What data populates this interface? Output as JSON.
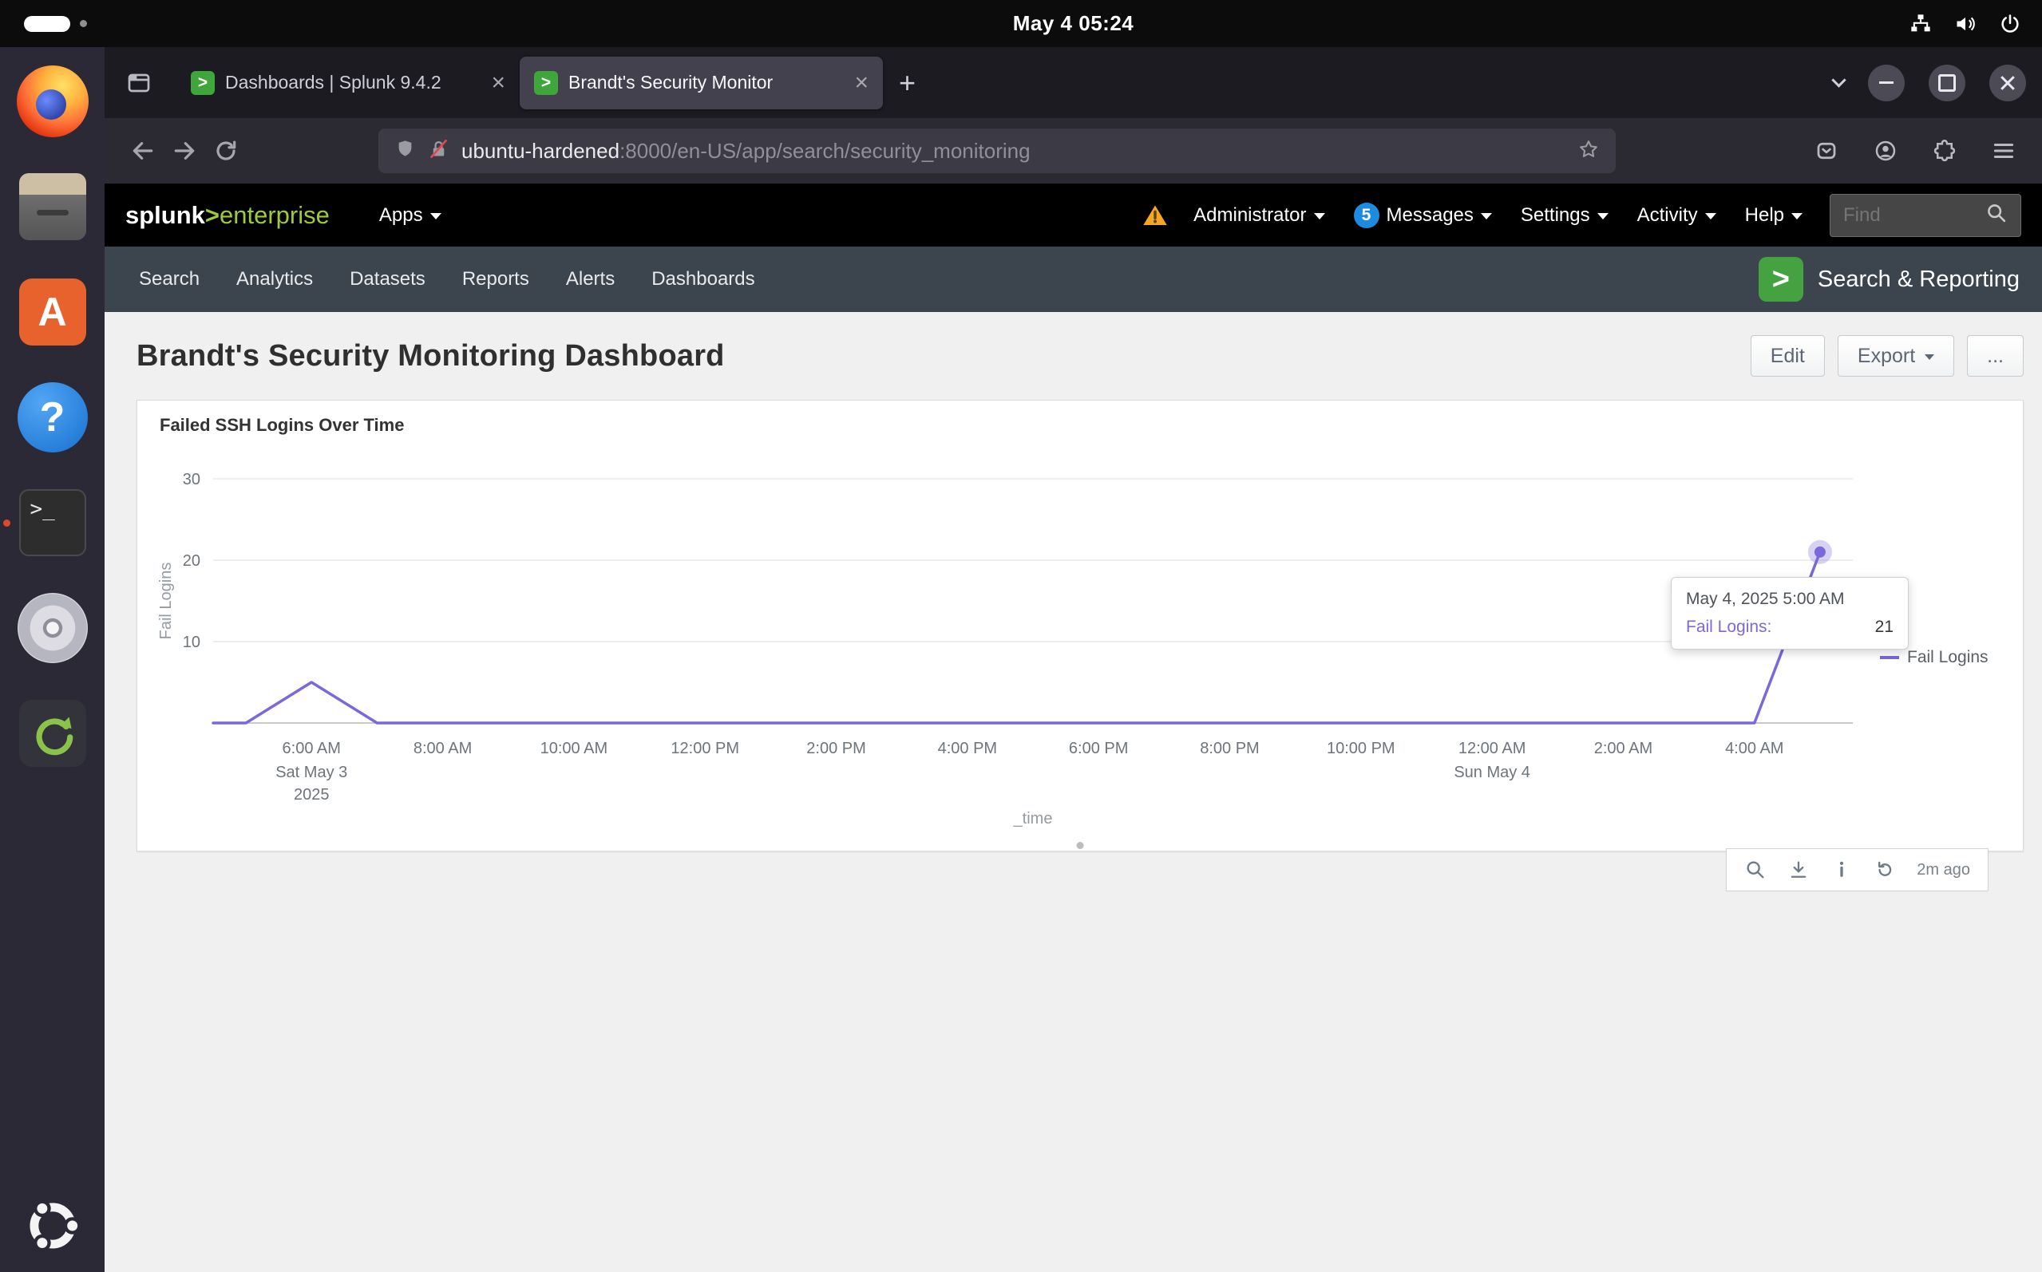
{
  "system_bar": {
    "clock": "May 4  05:24"
  },
  "dock": {
    "items": [
      "Firefox",
      "Files",
      "Text Editor",
      "Help",
      "Terminal",
      "Disc Burner",
      "Software Updater",
      "Ubuntu Desktop"
    ]
  },
  "browser": {
    "tabs": [
      {
        "label": "Dashboards | Splunk 9.4.2",
        "active": false
      },
      {
        "label": "Brandt's Security Monitor",
        "active": true
      }
    ],
    "new_tab": "+",
    "url_host": "ubuntu-hardened",
    "url_path": ":8000/en-US/app/search/security_monitoring"
  },
  "splunk_header": {
    "logo_splunk": "splunk",
    "logo_gt": ">",
    "logo_enterprise": "enterprise",
    "apps": "Apps",
    "administrator": "Administrator",
    "messages_count": "5",
    "messages": "Messages",
    "settings": "Settings",
    "activity": "Activity",
    "help": "Help",
    "find_placeholder": "Find"
  },
  "app_nav": {
    "items": [
      "Search",
      "Analytics",
      "Datasets",
      "Reports",
      "Alerts",
      "Dashboards"
    ],
    "app_logo_glyph": ">",
    "app_name": "Search & Reporting"
  },
  "page": {
    "title": "Brandt's Security Monitoring Dashboard",
    "edit": "Edit",
    "export": "Export",
    "more": "..."
  },
  "panel": {
    "title": "Failed SSH Logins Over Time",
    "refresh_age": "2m ago"
  },
  "tooltip": {
    "timestamp": "May 4, 2025 5:00 AM",
    "series": "Fail Logins:",
    "value": "21"
  },
  "icons": {
    "favicon": "green-splunk-chevron",
    "warning-icon": "orange-triangle-exclamation",
    "find-icon": "magnifier",
    "accent_green": "#44a340",
    "series_purple": "#7b68d9"
  },
  "chart_data": {
    "type": "line",
    "title": "Failed SSH Logins Over Time",
    "xlabel": "_time",
    "ylabel": "Fail Logins",
    "ylim": [
      0,
      32
    ],
    "yticks": [
      10,
      20,
      30
    ],
    "legend": [
      "Fail Logins"
    ],
    "legend_position": "right",
    "grid": "horizontal",
    "series_color": "#7b68d9",
    "x": [
      "5:00 AM",
      "6:00 AM",
      "7:00 AM",
      "8:00 AM",
      "9:00 AM",
      "10:00 AM",
      "11:00 AM",
      "12:00 PM",
      "1:00 PM",
      "2:00 PM",
      "3:00 PM",
      "4:00 PM",
      "5:00 PM",
      "6:00 PM",
      "7:00 PM",
      "8:00 PM",
      "9:00 PM",
      "10:00 PM",
      "11:00 PM",
      "12:00 AM",
      "1:00 AM",
      "2:00 AM",
      "3:00 AM",
      "4:00 AM",
      "5:00 AM"
    ],
    "values": [
      0,
      5,
      0,
      0,
      0,
      0,
      0,
      0,
      0,
      0,
      0,
      0,
      0,
      0,
      0,
      0,
      0,
      0,
      0,
      0,
      0,
      0,
      0,
      0,
      21
    ],
    "x_tick_labels": [
      {
        "index": 1,
        "label": "6:00 AM",
        "sub": [
          "Sat May 3",
          "2025"
        ]
      },
      {
        "index": 3,
        "label": "8:00 AM"
      },
      {
        "index": 5,
        "label": "10:00 AM"
      },
      {
        "index": 7,
        "label": "12:00 PM"
      },
      {
        "index": 9,
        "label": "2:00 PM"
      },
      {
        "index": 11,
        "label": "4:00 PM"
      },
      {
        "index": 13,
        "label": "6:00 PM"
      },
      {
        "index": 15,
        "label": "8:00 PM"
      },
      {
        "index": 17,
        "label": "10:00 PM"
      },
      {
        "index": 19,
        "label": "12:00 AM",
        "sub": [
          "Sun May 4"
        ]
      },
      {
        "index": 21,
        "label": "2:00 AM"
      },
      {
        "index": 23,
        "label": "4:00 AM"
      }
    ],
    "highlight_point": {
      "x_index": 24,
      "value": 21,
      "timestamp": "May 4, 2025 5:00 AM"
    }
  }
}
